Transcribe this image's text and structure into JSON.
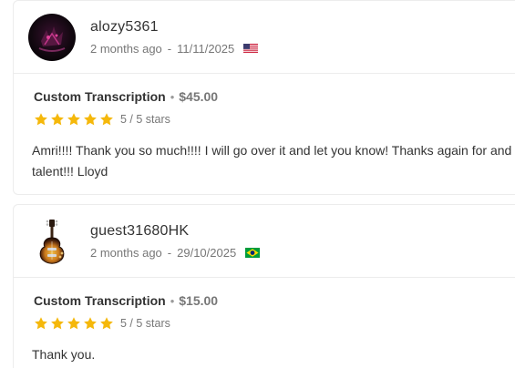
{
  "reviews": [
    {
      "username": "alozy5361",
      "time_ago": "2 months ago",
      "separator": "-",
      "date": "11/11/2025",
      "country_flag": "us-flag-icon",
      "service": "Custom Transcription",
      "dot": "•",
      "price": "$45.00",
      "rating": 5,
      "rating_text": "5 / 5 stars",
      "comment": "Amri!!!! Thank you so much!!!! I will go over it and let you know! Thanks again for and talent!!! Lloyd"
    },
    {
      "username": "guest31680HK",
      "time_ago": "2 months ago",
      "separator": "-",
      "date": "29/10/2025",
      "country_flag": "brazil-flag-icon",
      "service": "Custom Transcription",
      "dot": "•",
      "price": "$15.00",
      "rating": 5,
      "rating_text": "5 / 5 stars",
      "comment": "Thank you."
    }
  ],
  "colors": {
    "star": "#f5b80b",
    "muted": "#777777",
    "text": "#333333",
    "border": "#ececec"
  }
}
